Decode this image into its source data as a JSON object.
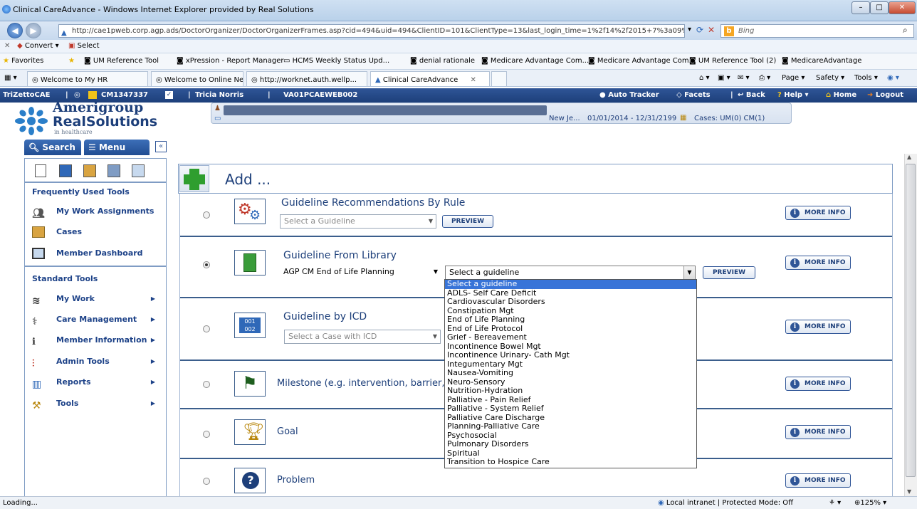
{
  "window": {
    "title": "Clinical CareAdvance - Windows Internet Explorer provided by Real Solutions",
    "url": "http://cae1pweb.corp.agp.ads/DoctorOrganizer/DoctorOrganizerFrames.asp?cid=494&uid=494&ClientID=101&ClientType=13&last_login_time=1%2f14%2f2015+7%3a09%3a17+AM",
    "search_placeholder": "Bing"
  },
  "commandbar": {
    "convert": "Convert",
    "select": "Select"
  },
  "favorites": {
    "label": "Favorites",
    "items": [
      "UM Reference Tool",
      "xPression - Report Manager",
      "HCMS Weekly Status Upd...",
      "denial rationale",
      "Medicare Advantage Com...",
      "Medicare Advantage Com...",
      "UM Reference Tool (2)",
      "MedicareAdvantage"
    ]
  },
  "tabs": [
    "Welcome to My HR",
    "Welcome to Online News !",
    "http://worknet.auth.wellp...",
    "Clinical CareAdvance"
  ],
  "ie_tools": {
    "page": "Page",
    "safety": "Safety",
    "tools": "Tools"
  },
  "appbar": {
    "brand": "TriZettoCAE",
    "case_id": "CM1347337",
    "user": "Tricia Norris",
    "server": "VA01PCAEWEB002",
    "auto_tracker": "Auto Tracker",
    "facets": "Facets",
    "back": "Back",
    "help": "Help",
    "home": "Home",
    "logout": "Logout"
  },
  "logo": {
    "line1": "Amerigroup",
    "line2": "RealSolutions",
    "line3": "in healthcare"
  },
  "member_info": {
    "plan_text": "New Je...",
    "dates": "01/01/2014 - 12/31/2199",
    "cases": "Cases: UM(0) CM(1)"
  },
  "sidebar": {
    "search_tab": "Search",
    "menu_tab": "Menu",
    "frequent_title": "Frequently Used Tools",
    "frequent": [
      "My Work Assignments",
      "Cases",
      "Member Dashboard"
    ],
    "standard_title": "Standard Tools",
    "standard": [
      "My Work",
      "Care Management",
      "Member Information",
      "Admin Tools",
      "Reports",
      "Tools"
    ]
  },
  "main": {
    "add_title": "Add ...",
    "rows": [
      {
        "title": "Guideline Recommendations By Rule",
        "select": "Select a Guideline",
        "preview": "PREVIEW",
        "more": "MORE INFO"
      },
      {
        "title": "Guideline From Library",
        "select1": "AGP CM End of Life Planning",
        "select2": "Select a guideline",
        "preview": "PREVIEW",
        "more": "MORE INFO"
      },
      {
        "title": "Guideline by ICD",
        "select": "Select a Case with ICD",
        "more": "MORE INFO"
      },
      {
        "title": "Milestone (e.g. intervention, barrier,",
        "more": "MORE INFO"
      },
      {
        "title": "Goal",
        "more": "MORE INFO"
      },
      {
        "title": "Problem",
        "more": "MORE INFO"
      }
    ]
  },
  "dropdown": {
    "options": [
      "Select a guideline",
      "ADLS- Self Care Deficit",
      "Cardiovascular Disorders",
      "Constipation Mgt",
      "End of Life Planning",
      "End of Life Protocol",
      "Grief - Bereavement",
      "Incontinence Bowel Mgt",
      "Incontinence Urinary- Cath Mgt",
      "Integumentary Mgt",
      "Nausea-Vomiting",
      "Neuro-Sensory",
      "Nutrition-Hydration",
      "Palliative - Pain Relief",
      "Palliative - System Relief",
      "Palliative Care Discharge",
      "Planning-Palliative Care",
      "Psychosocial",
      "Pulmonary Disorders",
      "Spiritual",
      "Transition to Hospice Care"
    ]
  },
  "status": {
    "left": "Loading...",
    "zone": "Local intranet | Protected Mode: Off",
    "zoom": "125%"
  }
}
